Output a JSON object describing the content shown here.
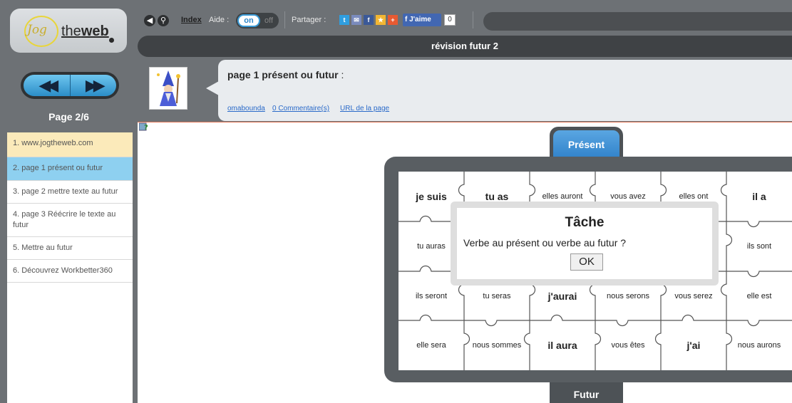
{
  "logo": {
    "jog": "Jog",
    "the": "the",
    "web": "web"
  },
  "nav": {
    "prev_icon": "rewind-icon",
    "next_icon": "fast-forward-icon",
    "page_indicator": "Page 2/6"
  },
  "pages": [
    {
      "label": "1. www.jogtheweb.com"
    },
    {
      "label": "2. page 1 présent ou futur"
    },
    {
      "label": "3. page 2 mettre texte au futur"
    },
    {
      "label": "4. page 3 Réécrire le texte au futur"
    },
    {
      "label": "5. Mettre au futur"
    },
    {
      "label": "6. Découvrez Workbetter360"
    }
  ],
  "toolbar": {
    "index_label": "Index",
    "aide_label": "Aide :",
    "toggle_on": "on",
    "toggle_off": "off",
    "partager_label": "Partager :",
    "like_label": "J'aime",
    "like_count": "0"
  },
  "title": "révision futur 2",
  "info": {
    "page_title": "page 1 présent ou futur",
    "page_title_suffix": " :",
    "author": "omabounda",
    "comments": "0 Commentaire(s)",
    "url_link": "URL de la page"
  },
  "puzzle": {
    "tab_top": "Présent",
    "tab_bottom": "Futur",
    "pieces": [
      {
        "text": "je suis",
        "big": true
      },
      {
        "text": "tu as",
        "big": true
      },
      {
        "text": "elles auront",
        "big": false
      },
      {
        "text": "vous avez",
        "big": false
      },
      {
        "text": "elles ont",
        "big": false
      },
      {
        "text": "il a",
        "big": true
      },
      {
        "text": "tu auras",
        "big": false
      },
      {
        "text": "",
        "big": false
      },
      {
        "text": "",
        "big": false
      },
      {
        "text": "",
        "big": false
      },
      {
        "text": "",
        "big": false
      },
      {
        "text": "ils sont",
        "big": false
      },
      {
        "text": "ils seront",
        "big": false
      },
      {
        "text": "tu seras",
        "big": false
      },
      {
        "text": "j'aurai",
        "big": true
      },
      {
        "text": "nous serons",
        "big": false
      },
      {
        "text": "vous serez",
        "big": false
      },
      {
        "text": "elle est",
        "big": false
      },
      {
        "text": "elle sera",
        "big": false
      },
      {
        "text": "nous sommes",
        "big": false
      },
      {
        "text": "il aura",
        "big": true
      },
      {
        "text": "vous êtes",
        "big": false
      },
      {
        "text": "j'ai",
        "big": true
      },
      {
        "text": "nous aurons",
        "big": false
      }
    ]
  },
  "dialog": {
    "title": "Tâche",
    "text": "Verbe au présent ou verbe au futur ?",
    "ok": "OK"
  },
  "colors": {
    "accent_blue": "#2d7fc8",
    "chrome_grey": "#6d7175",
    "active_item": "#8ed0f0",
    "first_item": "#fbeaba"
  }
}
